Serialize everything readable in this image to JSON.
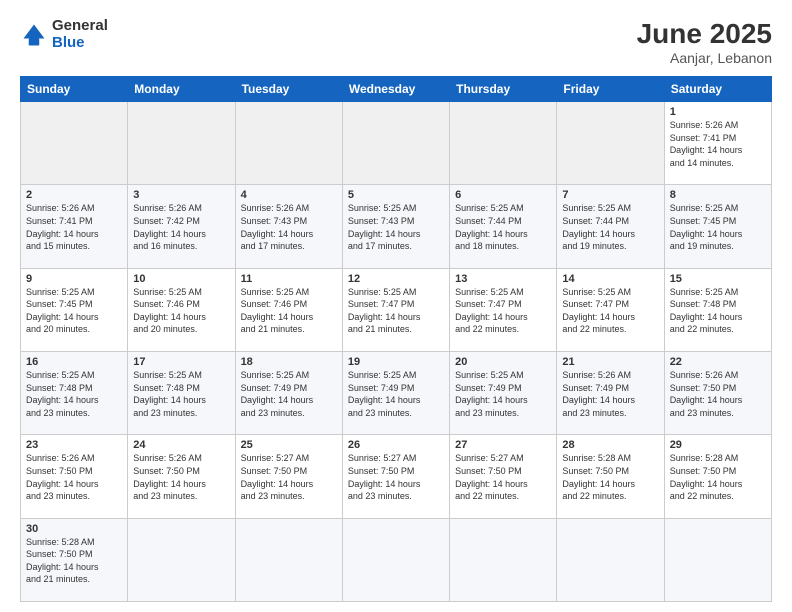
{
  "header": {
    "logo_general": "General",
    "logo_blue": "Blue",
    "month_title": "June 2025",
    "location": "Aanjar, Lebanon"
  },
  "weekdays": [
    "Sunday",
    "Monday",
    "Tuesday",
    "Wednesday",
    "Thursday",
    "Friday",
    "Saturday"
  ],
  "days": [
    {
      "num": "",
      "info": ""
    },
    {
      "num": "",
      "info": ""
    },
    {
      "num": "",
      "info": ""
    },
    {
      "num": "",
      "info": ""
    },
    {
      "num": "",
      "info": ""
    },
    {
      "num": "",
      "info": ""
    },
    {
      "num": "1",
      "info": "Sunrise: 5:26 AM\nSunset: 7:41 PM\nDaylight: 14 hours\nand 14 minutes."
    },
    {
      "num": "2",
      "info": "Sunrise: 5:26 AM\nSunset: 7:41 PM\nDaylight: 14 hours\nand 15 minutes."
    },
    {
      "num": "3",
      "info": "Sunrise: 5:26 AM\nSunset: 7:42 PM\nDaylight: 14 hours\nand 16 minutes."
    },
    {
      "num": "4",
      "info": "Sunrise: 5:26 AM\nSunset: 7:43 PM\nDaylight: 14 hours\nand 17 minutes."
    },
    {
      "num": "5",
      "info": "Sunrise: 5:25 AM\nSunset: 7:43 PM\nDaylight: 14 hours\nand 17 minutes."
    },
    {
      "num": "6",
      "info": "Sunrise: 5:25 AM\nSunset: 7:44 PM\nDaylight: 14 hours\nand 18 minutes."
    },
    {
      "num": "7",
      "info": "Sunrise: 5:25 AM\nSunset: 7:44 PM\nDaylight: 14 hours\nand 19 minutes."
    },
    {
      "num": "8",
      "info": "Sunrise: 5:25 AM\nSunset: 7:45 PM\nDaylight: 14 hours\nand 19 minutes."
    },
    {
      "num": "9",
      "info": "Sunrise: 5:25 AM\nSunset: 7:45 PM\nDaylight: 14 hours\nand 20 minutes."
    },
    {
      "num": "10",
      "info": "Sunrise: 5:25 AM\nSunset: 7:46 PM\nDaylight: 14 hours\nand 20 minutes."
    },
    {
      "num": "11",
      "info": "Sunrise: 5:25 AM\nSunset: 7:46 PM\nDaylight: 14 hours\nand 21 minutes."
    },
    {
      "num": "12",
      "info": "Sunrise: 5:25 AM\nSunset: 7:47 PM\nDaylight: 14 hours\nand 21 minutes."
    },
    {
      "num": "13",
      "info": "Sunrise: 5:25 AM\nSunset: 7:47 PM\nDaylight: 14 hours\nand 22 minutes."
    },
    {
      "num": "14",
      "info": "Sunrise: 5:25 AM\nSunset: 7:47 PM\nDaylight: 14 hours\nand 22 minutes."
    },
    {
      "num": "15",
      "info": "Sunrise: 5:25 AM\nSunset: 7:48 PM\nDaylight: 14 hours\nand 22 minutes."
    },
    {
      "num": "16",
      "info": "Sunrise: 5:25 AM\nSunset: 7:48 PM\nDaylight: 14 hours\nand 23 minutes."
    },
    {
      "num": "17",
      "info": "Sunrise: 5:25 AM\nSunset: 7:48 PM\nDaylight: 14 hours\nand 23 minutes."
    },
    {
      "num": "18",
      "info": "Sunrise: 5:25 AM\nSunset: 7:49 PM\nDaylight: 14 hours\nand 23 minutes."
    },
    {
      "num": "19",
      "info": "Sunrise: 5:25 AM\nSunset: 7:49 PM\nDaylight: 14 hours\nand 23 minutes."
    },
    {
      "num": "20",
      "info": "Sunrise: 5:25 AM\nSunset: 7:49 PM\nDaylight: 14 hours\nand 23 minutes."
    },
    {
      "num": "21",
      "info": "Sunrise: 5:26 AM\nSunset: 7:49 PM\nDaylight: 14 hours\nand 23 minutes."
    },
    {
      "num": "22",
      "info": "Sunrise: 5:26 AM\nSunset: 7:50 PM\nDaylight: 14 hours\nand 23 minutes."
    },
    {
      "num": "23",
      "info": "Sunrise: 5:26 AM\nSunset: 7:50 PM\nDaylight: 14 hours\nand 23 minutes."
    },
    {
      "num": "24",
      "info": "Sunrise: 5:26 AM\nSunset: 7:50 PM\nDaylight: 14 hours\nand 23 minutes."
    },
    {
      "num": "25",
      "info": "Sunrise: 5:27 AM\nSunset: 7:50 PM\nDaylight: 14 hours\nand 23 minutes."
    },
    {
      "num": "26",
      "info": "Sunrise: 5:27 AM\nSunset: 7:50 PM\nDaylight: 14 hours\nand 23 minutes."
    },
    {
      "num": "27",
      "info": "Sunrise: 5:27 AM\nSunset: 7:50 PM\nDaylight: 14 hours\nand 22 minutes."
    },
    {
      "num": "28",
      "info": "Sunrise: 5:28 AM\nSunset: 7:50 PM\nDaylight: 14 hours\nand 22 minutes."
    },
    {
      "num": "29",
      "info": "Sunrise: 5:28 AM\nSunset: 7:50 PM\nDaylight: 14 hours\nand 22 minutes."
    },
    {
      "num": "30",
      "info": "Sunrise: 5:28 AM\nSunset: 7:50 PM\nDaylight: 14 hours\nand 21 minutes."
    },
    {
      "num": "",
      "info": ""
    },
    {
      "num": "",
      "info": ""
    },
    {
      "num": "",
      "info": ""
    },
    {
      "num": "",
      "info": ""
    },
    {
      "num": "",
      "info": ""
    }
  ]
}
